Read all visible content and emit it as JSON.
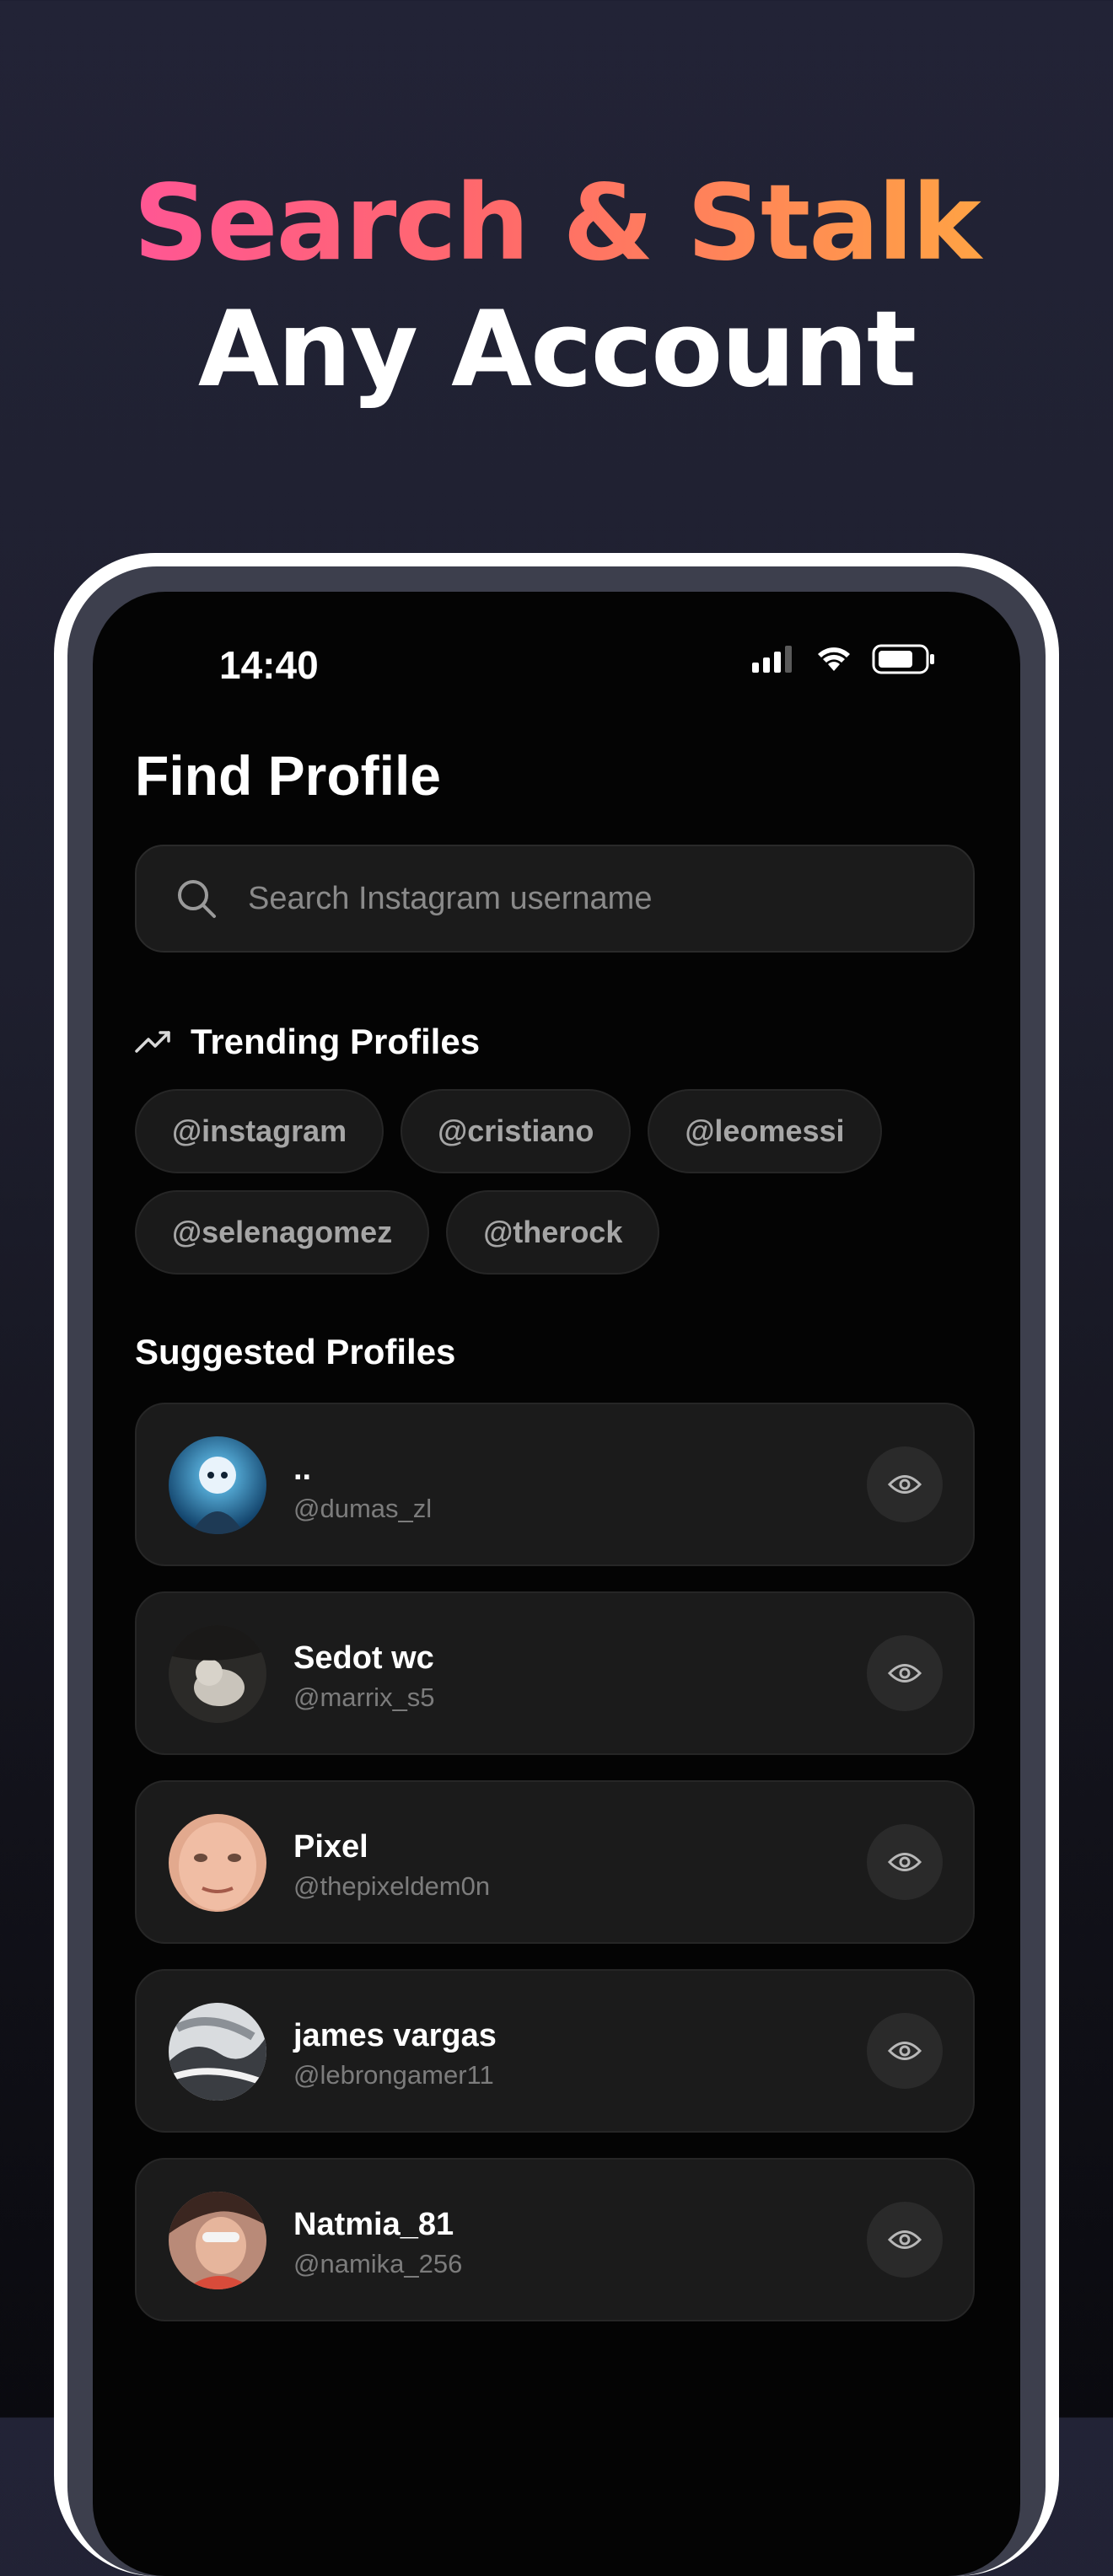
{
  "headline": {
    "line1": "Search & Stalk",
    "line2": "Any Account"
  },
  "status_bar": {
    "time": "14:40"
  },
  "page": {
    "title": "Find Profile"
  },
  "search": {
    "placeholder": "Search Instagram username",
    "value": ""
  },
  "trending": {
    "label": "Trending Profiles",
    "items": [
      "@instagram",
      "@cristiano",
      "@leomessi",
      "@selenagomez",
      "@therock"
    ]
  },
  "suggested": {
    "label": "Suggested Profiles",
    "items": [
      {
        "name": "..",
        "handle": "@dumas_zl"
      },
      {
        "name": "Sedot wc",
        "handle": "@marrix_s5"
      },
      {
        "name": "Pixel",
        "handle": "@thepixeldem0n"
      },
      {
        "name": "james vargas",
        "handle": "@lebrongamer11"
      },
      {
        "name": "Natmia_81",
        "handle": "@namika_256"
      }
    ]
  },
  "colors": {
    "accent_gradient_start": "#ff4fa3",
    "accent_gradient_end": "#ffb23a",
    "screen_bg": "#040404",
    "card_bg": "#1b1b1b"
  },
  "icons": [
    "signal-icon",
    "wifi-icon",
    "battery-icon",
    "search-icon",
    "trending-icon",
    "eye-icon"
  ]
}
